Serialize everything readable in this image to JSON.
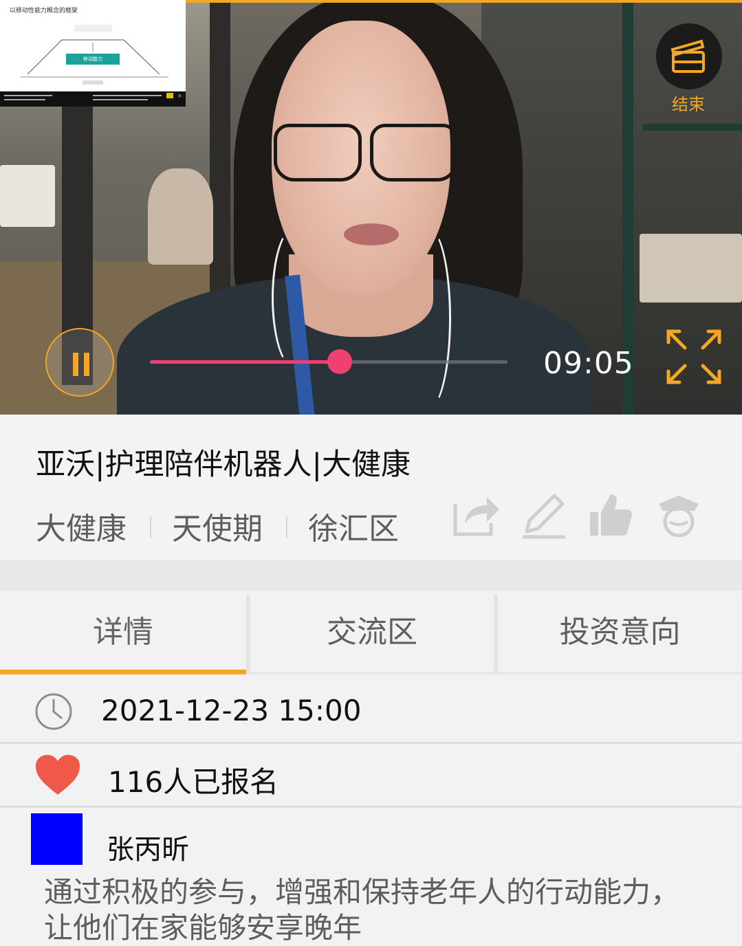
{
  "video": {
    "end_label": "结束",
    "time": "09:05",
    "progress_percent": 53,
    "slide_title": "以移动性能力概念的框架",
    "slide_button": "移动能力",
    "accent_color": "#f5a623",
    "progress_color": "#f0406f",
    "icons": {
      "end": "clapperboard-icon",
      "pause": "pause-icon",
      "fullscreen": "expand-icon"
    }
  },
  "event": {
    "title": "亚沃|护理陪伴机器人|大健康",
    "tags": [
      "大健康",
      "天使期",
      "徐汇区"
    ],
    "actions": [
      "share-icon",
      "edit-icon",
      "thumbs-up-icon",
      "officer-icon"
    ]
  },
  "tabs": [
    {
      "label": "详情",
      "active": true
    },
    {
      "label": "交流区",
      "active": false
    },
    {
      "label": "投资意向",
      "active": false
    }
  ],
  "details": {
    "datetime": "2021-12-23 15:00",
    "signup": "116人已报名",
    "author": "张丙昕",
    "description": "通过积极的参与，增强和保持老年人的行动能力，让他们在家能够安享晚年",
    "heart_color": "#f0584a",
    "avatar_color": "#0000ff"
  }
}
